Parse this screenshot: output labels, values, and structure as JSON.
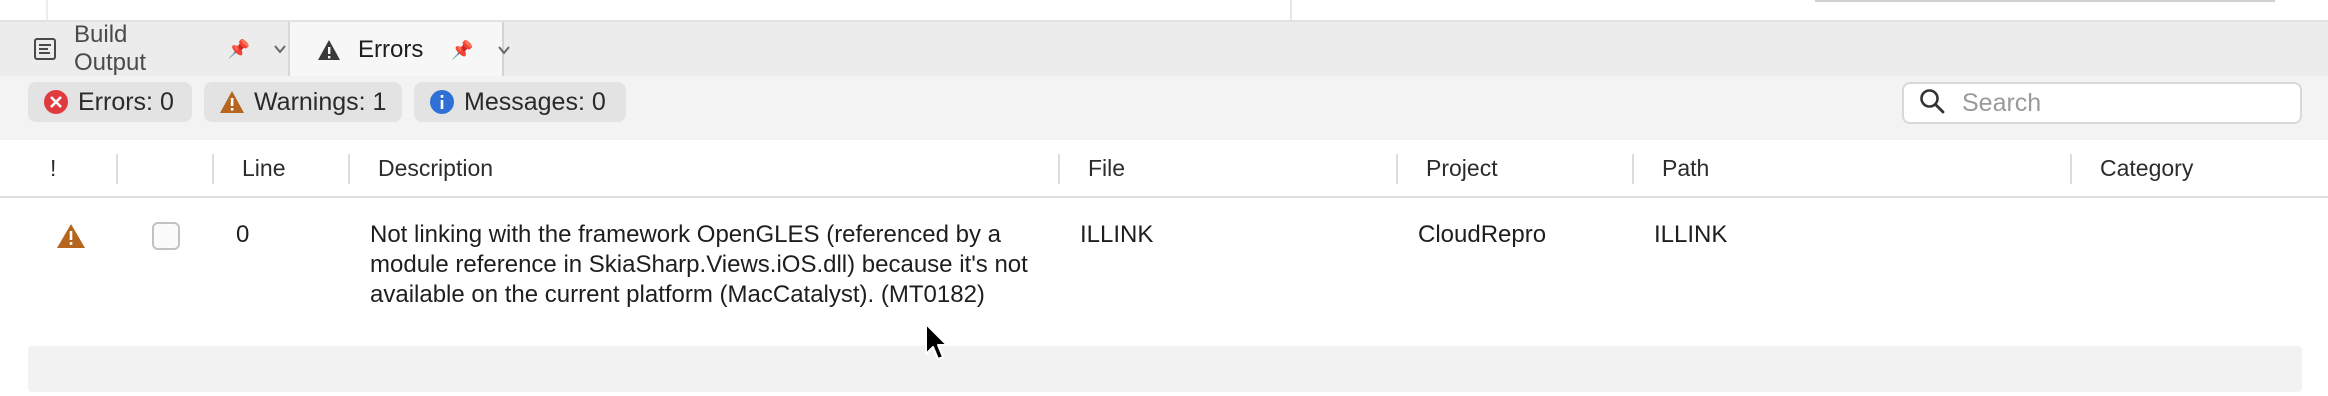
{
  "tabs": {
    "build_output": {
      "label": "Build Output",
      "pin": "📌"
    },
    "errors": {
      "label": "Errors",
      "pin": "📌"
    }
  },
  "filters": {
    "errors": "Errors: 0",
    "warnings": "Warnings: 1",
    "messages": "Messages: 0"
  },
  "search": {
    "placeholder": "Search",
    "value": ""
  },
  "columns": {
    "severity": "!",
    "line": "Line",
    "description": "Description",
    "file": "File",
    "project": "Project",
    "path": "Path",
    "category": "Category"
  },
  "rows": [
    {
      "severity_icon": "warning-icon",
      "line": "0",
      "description": "Not linking with the framework OpenGLES (referenced by a module reference in SkiaSharp.Views.iOS.dll) because it's not available on the current platform (MacCatalyst). (MT0182)",
      "file": "ILLINK",
      "project": "CloudRepro",
      "path": "ILLINK",
      "category": ""
    }
  ],
  "colors": {
    "error": "#e0393e",
    "warning": "#b5651d",
    "info": "#2f6fd6"
  }
}
